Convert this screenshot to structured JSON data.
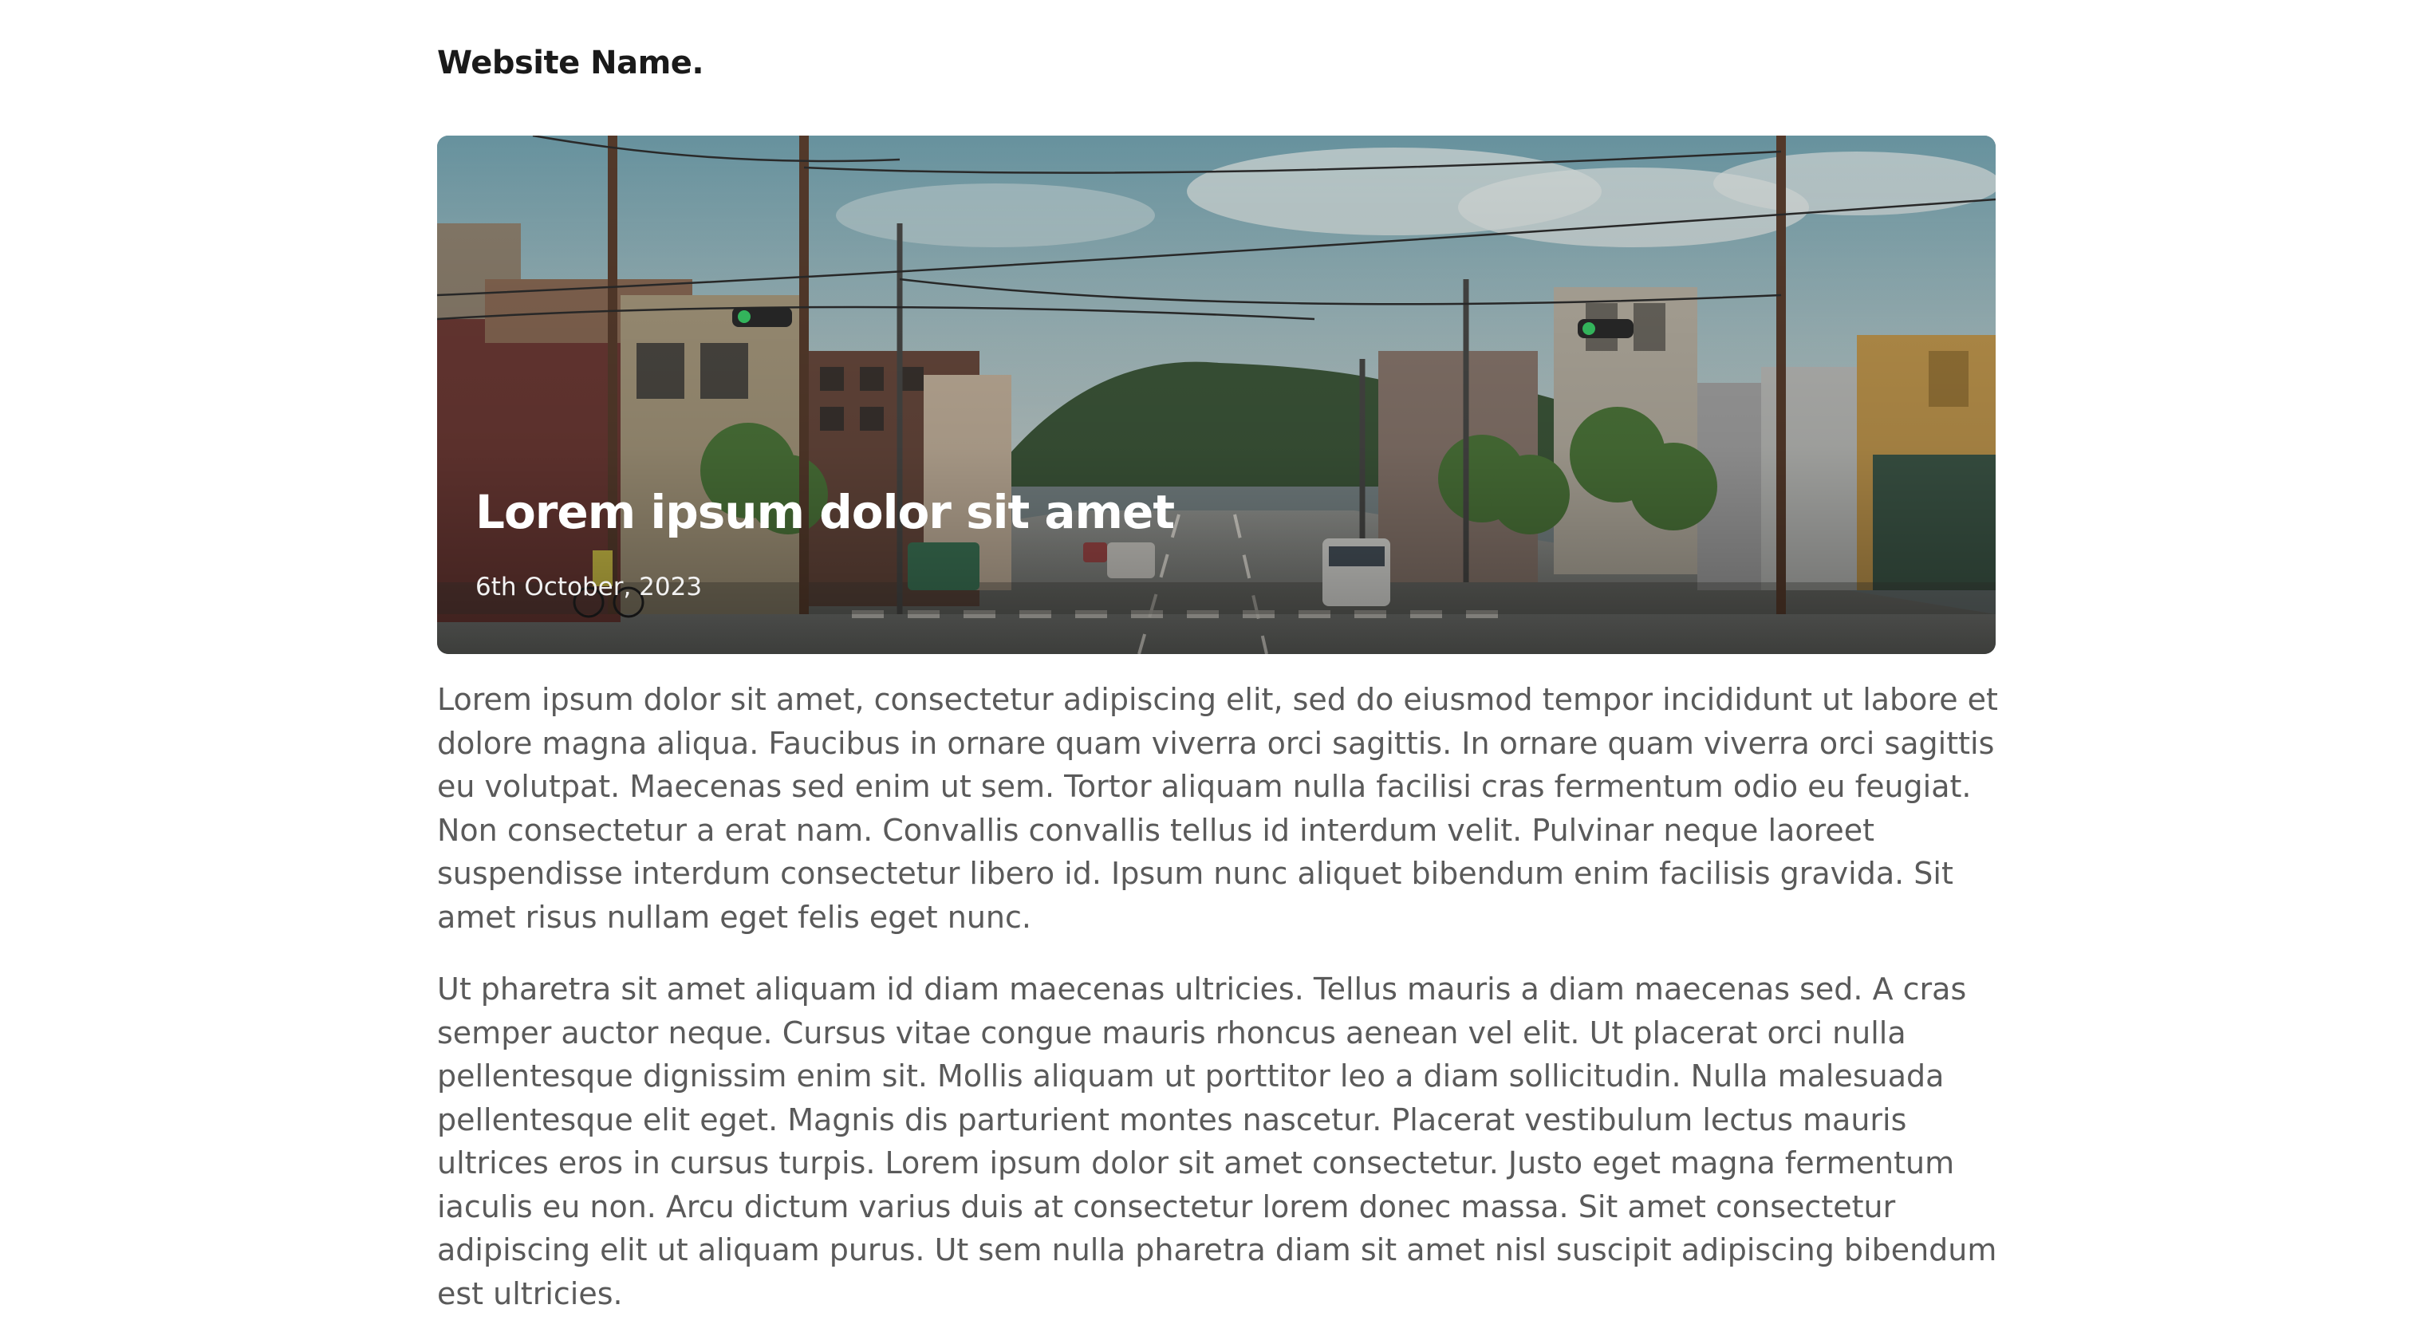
{
  "site": {
    "name": "Website Name."
  },
  "hero": {
    "title": "Lorem ipsum dolor sit amet",
    "date": "6th October, 2023",
    "image": "street-scene-photo"
  },
  "article": {
    "paragraphs": [
      "Lorem ipsum dolor sit amet, consectetur adipiscing elit, sed do eiusmod tempor incididunt ut labore et dolore magna aliqua. Faucibus in ornare quam viverra orci sagittis. In ornare quam viverra orci sagittis eu volutpat. Maecenas sed enim ut sem. Tortor aliquam nulla facilisi cras fermentum odio eu feugiat. Non consectetur a erat nam. Convallis convallis tellus id interdum velit. Pulvinar neque laoreet suspendisse interdum consectetur libero id. Ipsum nunc aliquet bibendum enim facilisis gravida. Sit amet risus nullam eget felis eget nunc.",
      "Ut pharetra sit amet aliquam id diam maecenas ultricies. Tellus mauris a diam maecenas sed. A cras semper auctor neque. Cursus vitae congue mauris rhoncus aenean vel elit. Ut placerat orci nulla pellentesque dignissim enim sit. Mollis aliquam ut porttitor leo a diam sollicitudin. Nulla malesuada pellentesque elit eget. Magnis dis parturient montes nascetur. Placerat vestibulum lectus mauris ultrices eros in cursus turpis. Lorem ipsum dolor sit amet consectetur. Justo eget magna fermentum iaculis eu non. Arcu dictum varius duis at consectetur lorem donec massa. Sit amet consectetur adipiscing elit ut aliquam purus. Ut sem nulla pharetra diam sit amet nisl suscipit adipiscing bibendum est ultricies."
    ]
  }
}
